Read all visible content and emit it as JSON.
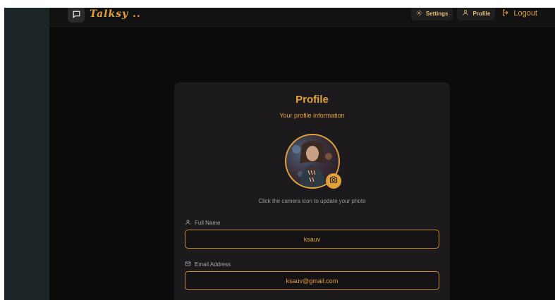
{
  "header": {
    "brand": "Talksy ..",
    "settings_label": "Settings",
    "profile_label": "Profile",
    "logout_label": "Logout"
  },
  "profile": {
    "title": "Profile",
    "subtitle": "Your profile information",
    "hint": "Click the camera icon to update your photo",
    "fields": [
      {
        "label": "Full Name",
        "icon": "user-icon",
        "value": "ksauv"
      },
      {
        "label": "Email Address",
        "icon": "mail-icon",
        "value": "ksauv@gmail.com"
      }
    ]
  },
  "colors": {
    "accent": "#e0a13a",
    "background": "#0b0b0b",
    "card": "#1c1a1c",
    "sidebar": "#1b2528"
  },
  "icons": [
    "message-square-icon",
    "gear-icon",
    "user-icon",
    "logout-icon",
    "camera-icon",
    "mail-icon"
  ]
}
